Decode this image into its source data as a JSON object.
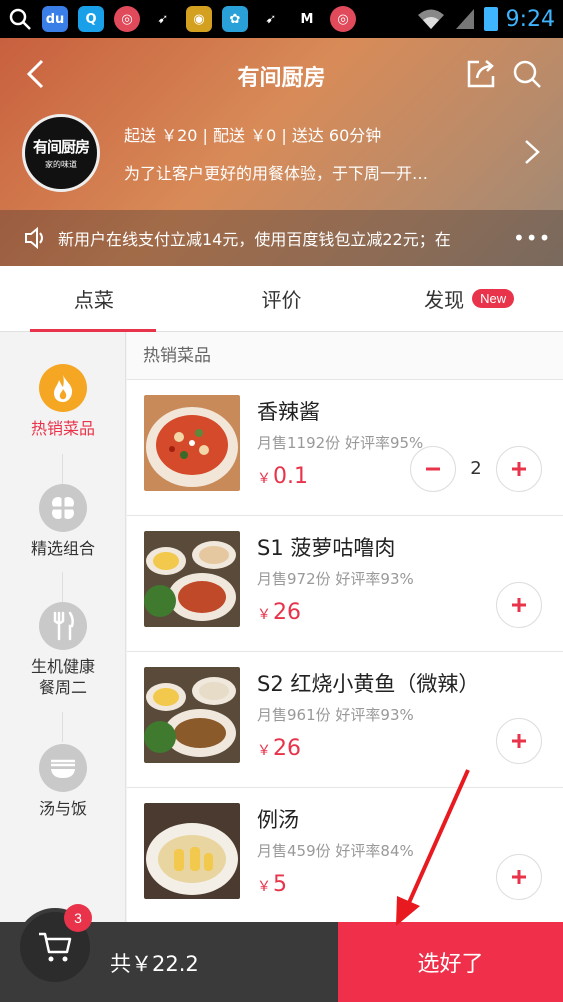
{
  "status_bar": {
    "time": "9:24"
  },
  "header": {
    "title": "有间厨房",
    "logo_text": "有间厨房",
    "logo_sub": "家的味道",
    "delivery_info": "起送 ￥20 | 配送 ￥0 | 送达 60分钟",
    "announcement": "为了让客户更好的用餐体验，于下周一开…",
    "promo": "新用户在线支付立减14元，使用百度钱包立减22元；在"
  },
  "tabs": [
    {
      "label": "点菜"
    },
    {
      "label": "评价"
    },
    {
      "label": "发现",
      "badge": "New"
    }
  ],
  "categories": [
    {
      "label": "热销菜品",
      "icon": "flame-icon"
    },
    {
      "label": "精选组合",
      "icon": "clover-icon"
    },
    {
      "label": "生机健康\n餐周二",
      "icon": "fork-knife-icon"
    },
    {
      "label": "汤与饭",
      "icon": "bowl-icon"
    }
  ],
  "section_title": "热销菜品",
  "items": [
    {
      "name": "香辣酱",
      "sales": "月售1192份 好评率95%",
      "currency": "￥",
      "price": "0.1",
      "qty": "2"
    },
    {
      "name": "S1 菠萝咕噜肉",
      "sales": "月售972份 好评率93%",
      "currency": "￥",
      "price": "26"
    },
    {
      "name": "S2 红烧小黄鱼（微辣）",
      "sales": "月售961份 好评率93%",
      "currency": "￥",
      "price": "26"
    },
    {
      "name": "例汤",
      "sales": "月售459份 好评率84%",
      "currency": "￥",
      "price": "5"
    }
  ],
  "cart": {
    "count": "3",
    "total": "共￥22.2",
    "confirm_label": "选好了"
  },
  "colors": {
    "accent": "#e8334a",
    "cart_bg": "#3a3a3a"
  }
}
